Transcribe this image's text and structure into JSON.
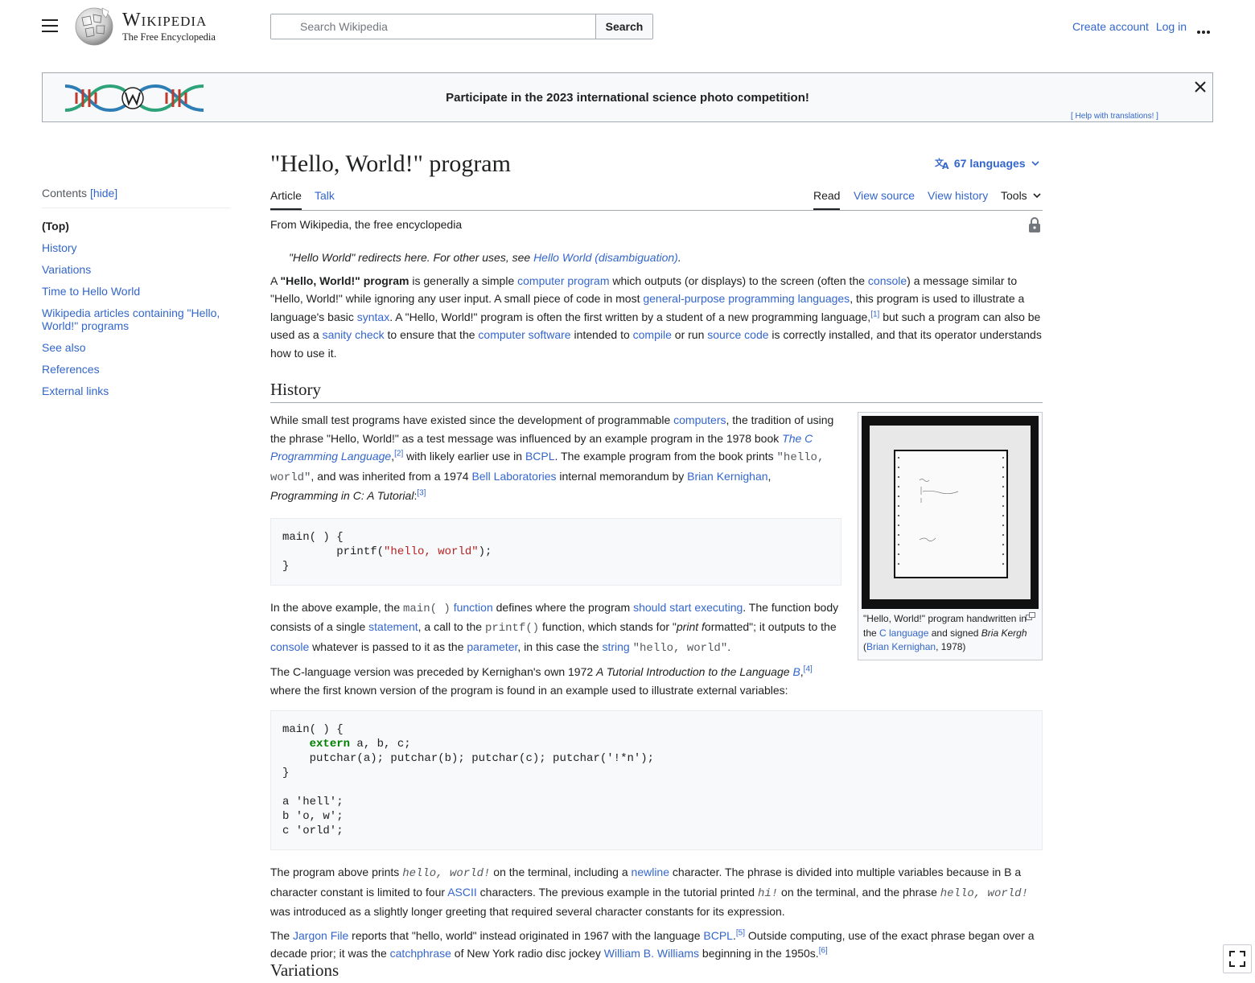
{
  "header": {
    "wordmark": "Wikipedia",
    "tagline": "The Free Encyclopedia",
    "search_placeholder": "Search Wikipedia",
    "search_button": "Search",
    "create_account": "Create account",
    "log_in": "Log in"
  },
  "banner": {
    "title": "Participate in the 2023 international science photo competition!",
    "help": "[ Help with translations! ]"
  },
  "toc": {
    "heading": "Contents",
    "hide": "[hide]",
    "items": [
      "(Top)",
      "History",
      "Variations",
      "Time to Hello World",
      "Wikipedia articles containing \"Hello, World!\" programs",
      "See also",
      "References",
      "External links"
    ]
  },
  "article": {
    "title": "\"Hello, World!\" program",
    "languages": "67 languages",
    "tabs": {
      "article": "Article",
      "talk": "Talk",
      "read": "Read",
      "view_source": "View source",
      "view_history": "View history",
      "tools": "Tools"
    },
    "from": "From Wikipedia, the free encyclopedia",
    "hatnote_pre": "\"Hello World\" redirects here. For other uses, see ",
    "hatnote_link": "Hello World (disambiguation)",
    "hatnote_post": ".",
    "history_heading": "History",
    "variations_heading": "Variations",
    "code1": {
      "l1": "main( ) {",
      "l2a": "        printf(",
      "l2b": "\"hello, world\"",
      "l2c": ");",
      "l3": "}"
    },
    "code2": {
      "l1": "main( ) {",
      "l2a": "    ",
      "l2kw": "extern",
      "l2b": " a, b, c;",
      "l3": "    putchar(a); putchar(b); putchar(c); putchar('!*n');",
      "l4": "}",
      "l5": "",
      "l6": "a 'hell';",
      "l7": "b 'o, w';",
      "l8": "c 'orld';"
    },
    "figure": {
      "cap1": "\"Hello, World!\" program handwritten in the ",
      "cap_link1": "C language",
      "cap2": " and signed ",
      "cap_it": "Bria Kergh",
      "cap3": " (",
      "cap_link2": "Brian Kernighan",
      "cap4": ", 1978)"
    }
  },
  "colors": {
    "link": "#3366cc",
    "text": "#202122",
    "border": "#a2a9b1",
    "code_bg": "#f8f9fa",
    "keyword": "#008000",
    "string": "#ba2121"
  }
}
